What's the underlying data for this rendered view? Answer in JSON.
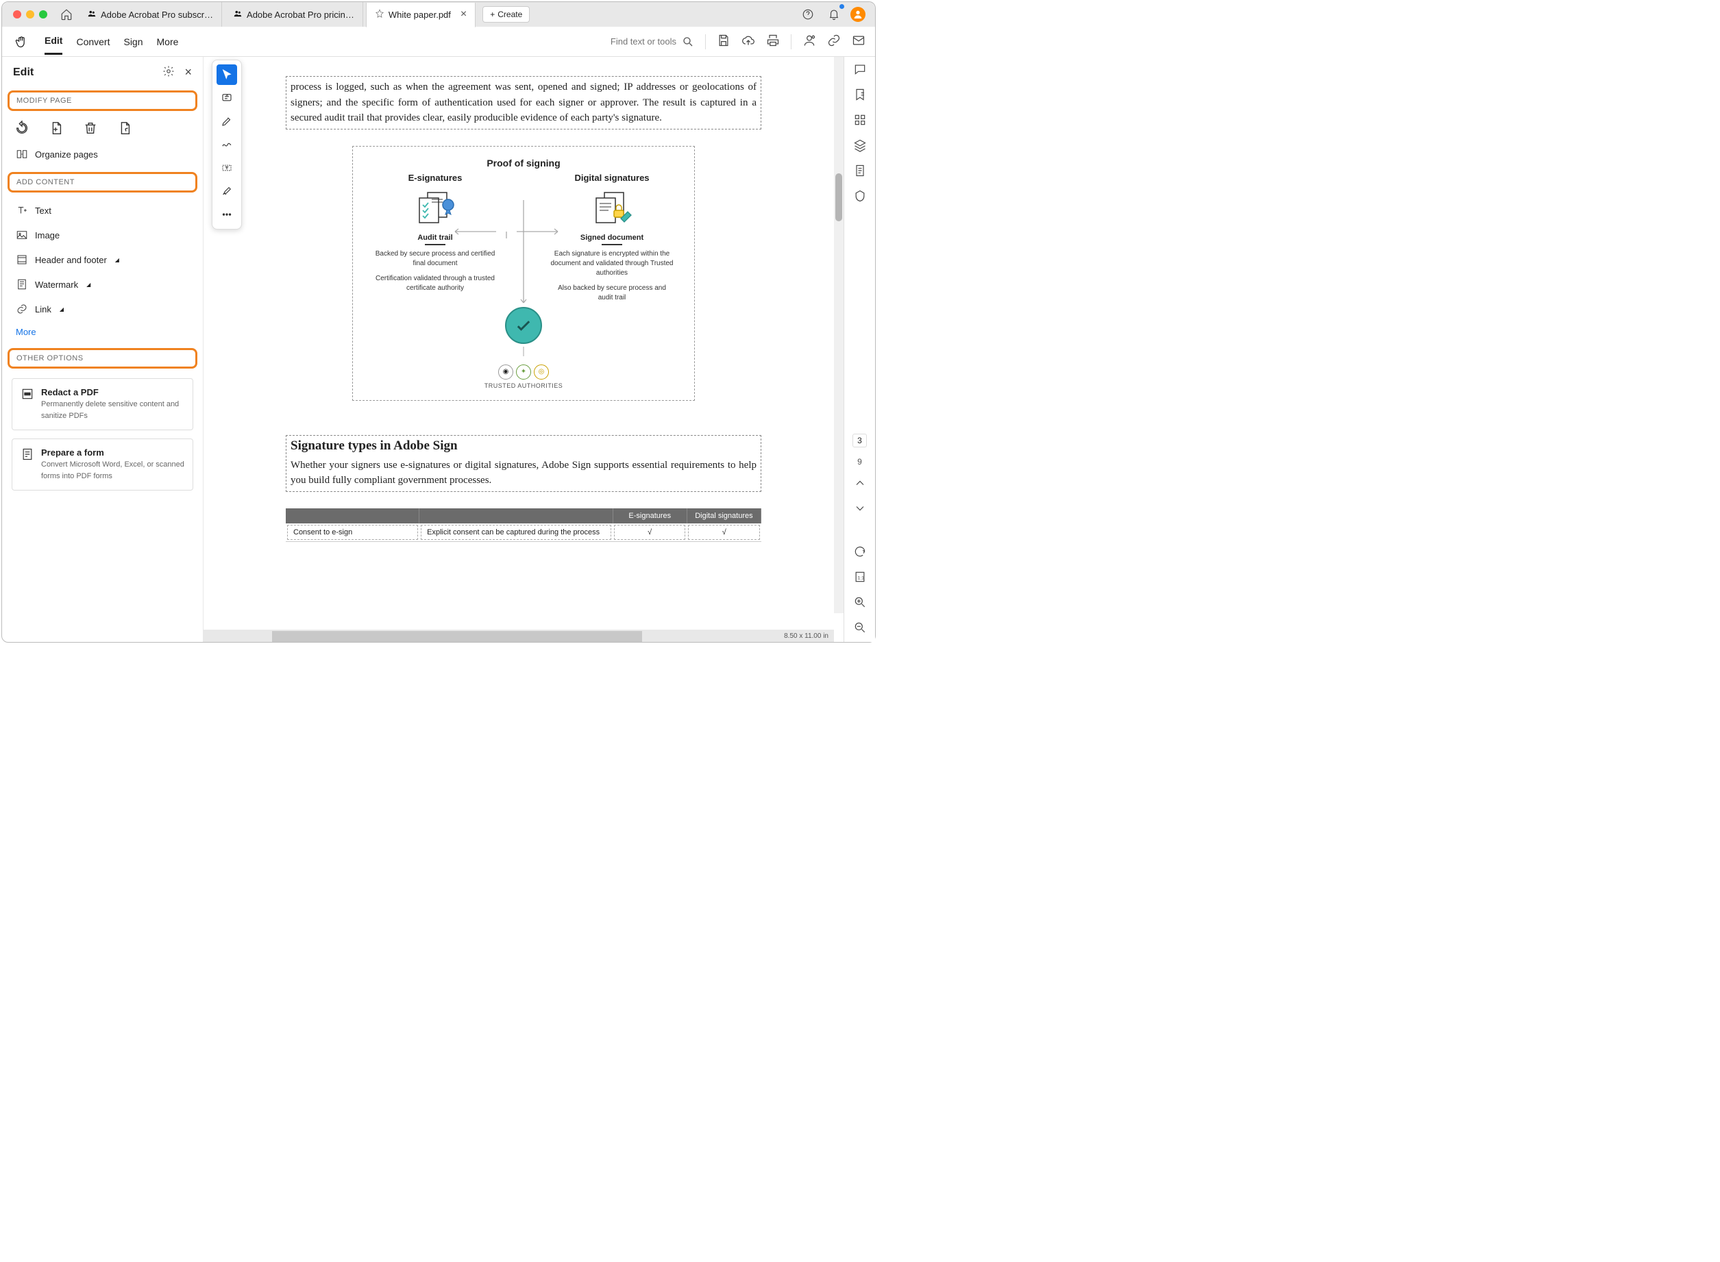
{
  "tabs": {
    "t1": "Adobe Acrobat Pro subscr…",
    "t2": "Adobe Acrobat Pro pricin…",
    "t3": "White paper.pdf",
    "create": "Create"
  },
  "toolbar": {
    "edit": "Edit",
    "convert": "Convert",
    "sign": "Sign",
    "more": "More",
    "search_placeholder": "Find text or tools"
  },
  "sidebar": {
    "title": "Edit",
    "sec1": "MODIFY PAGE",
    "organize": "Organize pages",
    "sec2": "ADD CONTENT",
    "text": "Text",
    "image": "Image",
    "header_footer": "Header and footer",
    "watermark": "Watermark",
    "link": "Link",
    "more": "More",
    "sec3": "OTHER OPTIONS",
    "card1": {
      "title": "Redact a PDF",
      "desc": "Permanently delete sensitive content and sanitize PDFs"
    },
    "card2": {
      "title": "Prepare a form",
      "desc": "Convert Microsoft Word, Excel, or scanned forms into PDF forms"
    }
  },
  "doc": {
    "para1": "process is logged, such as when the agreement was sent, opened and signed; IP addresses or geolocations of signers; and the specific form of authentication used for each signer or approver. The result is captured in a secured audit trail that provides clear, easily producible evidence of each party's signature.",
    "diagram": {
      "title": "Proof of signing",
      "left": {
        "title": "E-signatures",
        "sub": "Audit trail",
        "d1": "Backed by secure process and certified final document",
        "d2": "Certification validated through a trusted certificate authority"
      },
      "right": {
        "title": "Digital  signatures",
        "sub": "Signed document",
        "d1": "Each signature is encrypted within the document and validated through Trusted authorities",
        "d2": "Also backed by secure process and audit trail"
      },
      "trusted": "TRUSTED AUTHORITIES"
    },
    "h2": "Signature types in Adobe Sign",
    "p2": "Whether your signers use e-signatures or digital signatures, Adobe Sign supports essential requirements to help you build fully compliant government processes.",
    "table": {
      "h1": "",
      "h2_empty": "",
      "h3": "E-signatures",
      "h4": "Digital signatures",
      "r1c1": "Consent to e-sign",
      "r1c2": "Explicit consent can be captured during the process",
      "check": "√"
    }
  },
  "rail": {
    "page": "3",
    "total": "9"
  },
  "status": {
    "dim": "8.50 x 11.00 in"
  }
}
